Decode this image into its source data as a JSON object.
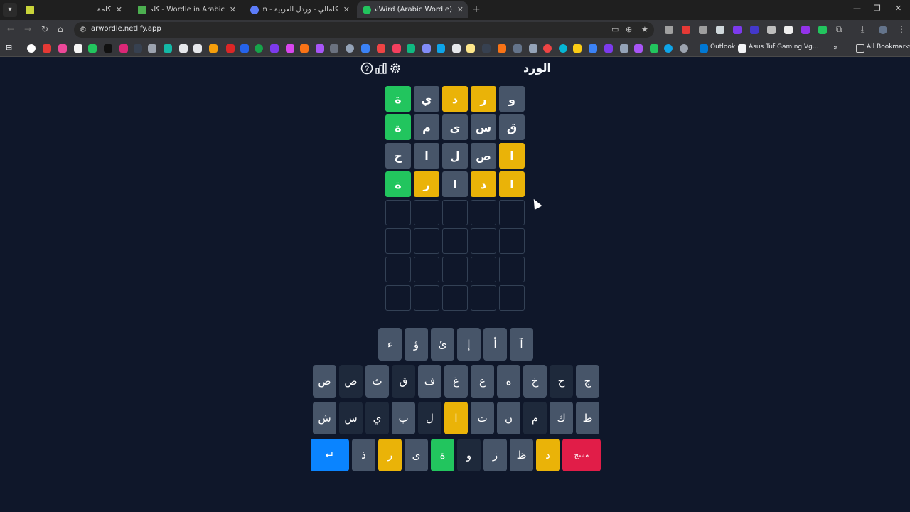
{
  "browser": {
    "tabs": [
      {
        "title": "كلمة",
        "favicon_color": "#c9d43a",
        "active": false
      },
      {
        "title": "Wordle in Arabic - كلمات",
        "favicon_color": "#4caf50",
        "active": false
      },
      {
        "title": "كلمالي - وردل العربية - naly.com",
        "favicon_color": "#5c7cfa",
        "active": false
      },
      {
        "title": "AlWird (Arabic Wordle) - الورد",
        "favicon_color": "#22c55e",
        "active": true
      }
    ],
    "url": "arwordle.netlify.app",
    "bookmarks": {
      "outlook_label": "Outlook",
      "asus_label": "Asus Tuf Gaming Vg...",
      "all_bookmarks_label": "All Bookmarks"
    }
  },
  "game": {
    "title": "الورد",
    "icons": [
      "help-icon",
      "stats-icon",
      "settings-icon"
    ],
    "board": [
      [
        {
          "l": "و",
          "s": "gray"
        },
        {
          "l": "ر",
          "s": "yellow"
        },
        {
          "l": "د",
          "s": "yellow"
        },
        {
          "l": "ي",
          "s": "gray"
        },
        {
          "l": "ة",
          "s": "green"
        }
      ],
      [
        {
          "l": "ق",
          "s": "gray"
        },
        {
          "l": "س",
          "s": "gray"
        },
        {
          "l": "ي",
          "s": "gray"
        },
        {
          "l": "م",
          "s": "gray"
        },
        {
          "l": "ة",
          "s": "green"
        }
      ],
      [
        {
          "l": "ا",
          "s": "yellow"
        },
        {
          "l": "ص",
          "s": "gray"
        },
        {
          "l": "ل",
          "s": "gray"
        },
        {
          "l": "ا",
          "s": "gray"
        },
        {
          "l": "ح",
          "s": "gray"
        }
      ],
      [
        {
          "l": "ا",
          "s": "yellow"
        },
        {
          "l": "د",
          "s": "yellow"
        },
        {
          "l": "ا",
          "s": "gray"
        },
        {
          "l": "ر",
          "s": "yellow"
        },
        {
          "l": "ة",
          "s": "green"
        }
      ],
      [
        {
          "l": "",
          "s": "empty"
        },
        {
          "l": "",
          "s": "empty"
        },
        {
          "l": "",
          "s": "empty"
        },
        {
          "l": "",
          "s": "empty"
        },
        {
          "l": "",
          "s": "empty"
        }
      ],
      [
        {
          "l": "",
          "s": "empty"
        },
        {
          "l": "",
          "s": "empty"
        },
        {
          "l": "",
          "s": "empty"
        },
        {
          "l": "",
          "s": "empty"
        },
        {
          "l": "",
          "s": "empty"
        }
      ],
      [
        {
          "l": "",
          "s": "empty"
        },
        {
          "l": "",
          "s": "empty"
        },
        {
          "l": "",
          "s": "empty"
        },
        {
          "l": "",
          "s": "empty"
        },
        {
          "l": "",
          "s": "empty"
        }
      ],
      [
        {
          "l": "",
          "s": "empty"
        },
        {
          "l": "",
          "s": "empty"
        },
        {
          "l": "",
          "s": "empty"
        },
        {
          "l": "",
          "s": "empty"
        },
        {
          "l": "",
          "s": "empty"
        }
      ]
    ],
    "keyboard": {
      "row1": [
        {
          "k": "آ",
          "s": "normal"
        },
        {
          "k": "أ",
          "s": "normal"
        },
        {
          "k": "إ",
          "s": "normal"
        },
        {
          "k": "ئ",
          "s": "normal"
        },
        {
          "k": "ؤ",
          "s": "normal"
        },
        {
          "k": "ء",
          "s": "normal"
        }
      ],
      "row2": [
        {
          "k": "ج",
          "s": "normal"
        },
        {
          "k": "ح",
          "s": "absent"
        },
        {
          "k": "خ",
          "s": "normal"
        },
        {
          "k": "ه",
          "s": "normal"
        },
        {
          "k": "ع",
          "s": "normal"
        },
        {
          "k": "غ",
          "s": "normal"
        },
        {
          "k": "ف",
          "s": "normal"
        },
        {
          "k": "ق",
          "s": "absent"
        },
        {
          "k": "ث",
          "s": "normal"
        },
        {
          "k": "ص",
          "s": "absent"
        },
        {
          "k": "ض",
          "s": "normal"
        }
      ],
      "row3": [
        {
          "k": "ط",
          "s": "normal"
        },
        {
          "k": "ك",
          "s": "normal"
        },
        {
          "k": "م",
          "s": "absent"
        },
        {
          "k": "ن",
          "s": "normal"
        },
        {
          "k": "ت",
          "s": "normal"
        },
        {
          "k": "ا",
          "s": "yellow"
        },
        {
          "k": "ل",
          "s": "absent"
        },
        {
          "k": "ب",
          "s": "normal"
        },
        {
          "k": "ي",
          "s": "absent"
        },
        {
          "k": "س",
          "s": "absent"
        },
        {
          "k": "ش",
          "s": "normal"
        }
      ],
      "row4": [
        {
          "k": "مسح",
          "s": "del"
        },
        {
          "k": "د",
          "s": "yellow"
        },
        {
          "k": "ظ",
          "s": "normal"
        },
        {
          "k": "ز",
          "s": "normal"
        },
        {
          "k": "و",
          "s": "absent"
        },
        {
          "k": "ة",
          "s": "green"
        },
        {
          "k": "ى",
          "s": "normal"
        },
        {
          "k": "ر",
          "s": "yellow"
        },
        {
          "k": "ذ",
          "s": "normal"
        },
        {
          "k": "↵",
          "s": "enter"
        }
      ]
    }
  }
}
